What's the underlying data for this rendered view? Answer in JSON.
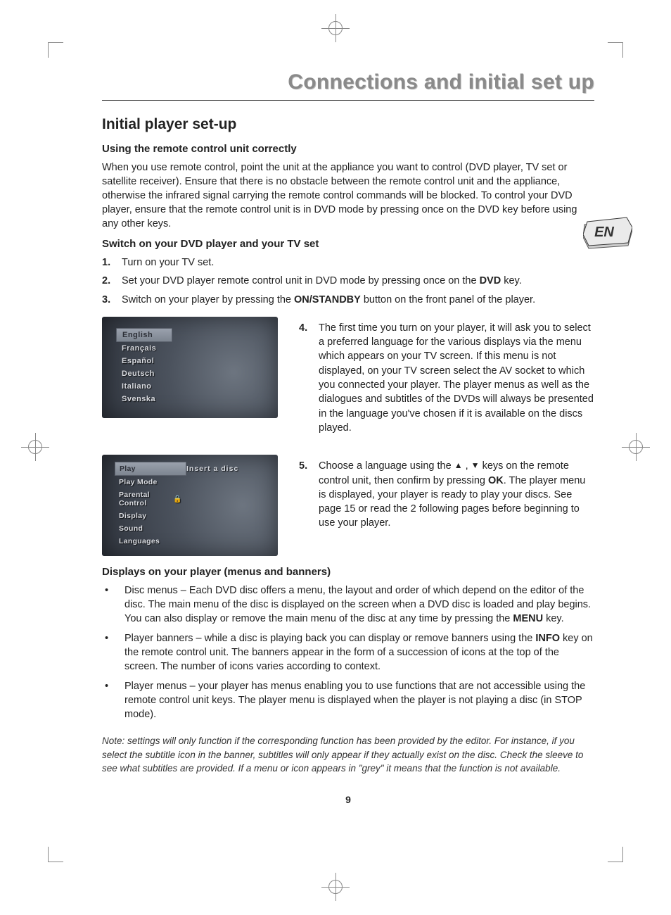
{
  "page_title": "Connections and initial set up",
  "section_heading": "Initial player set-up",
  "sub1_heading": "Using the remote control unit correctly",
  "sub1_body": "When you use remote control, point the unit at the appliance you want to control (DVD player, TV set or satellite receiver). Ensure that there is no obstacle between the remote control unit and the appliance, otherwise the infrared signal carrying the remote control commands will be blocked. To control your DVD player, ensure that the remote control unit is in DVD mode by pressing once on the DVD key before using any other keys.",
  "sub2_heading": "Switch on your DVD player and your TV set",
  "steps_1_3": [
    {
      "n": "1.",
      "text": "Turn on your TV set."
    },
    {
      "n": "2.",
      "pre": "Set your DVD player remote control unit in DVD mode by pressing once on the ",
      "bold": "DVD",
      "post": " key."
    },
    {
      "n": "3.",
      "pre": "Switch on your player by pressing the ",
      "bold": "ON/STANDBY",
      "post": " button on the front panel of the player."
    }
  ],
  "lang_menu": [
    "English",
    "Français",
    "Español",
    "Deutsch",
    "Italiano",
    "Svenska"
  ],
  "lang_selected_index": 0,
  "step4": {
    "n": "4.",
    "text": "The first time you turn on your player, it will ask you to select a preferred language for the various displays via the menu which appears on your TV screen. If this menu is not displayed, on your TV screen select the AV socket to which you connected your player. The player menus as well as the dialogues and subtitles of the DVDs will always be presented in the language you've chosen if it is available on the discs played."
  },
  "player_menu": {
    "items": [
      "Play",
      "Play Mode",
      "Parental Control",
      "Display",
      "Sound",
      "Languages"
    ],
    "selected_index": 0,
    "lock_index": 2,
    "right_label": "Insert a disc"
  },
  "step5": {
    "n": "5.",
    "pre1": "Choose a language using the ",
    "mid": " keys on the remote control unit, then confirm by pressing ",
    "bold": "OK",
    "post": ". The player menu is displayed, your player is ready to play your discs. See page 15 or read the 2 following pages before beginning to use your player."
  },
  "sub3_heading": "Displays on your player (menus and banners)",
  "bullets": [
    {
      "pre": "Disc menus – Each DVD disc offers a menu, the layout and order of which depend on the editor of the disc. The main menu of the disc is displayed on the screen when a DVD disc is loaded and play begins. You can also display or remove the main menu of the disc at any time by pressing the ",
      "bold": "MENU",
      "post": " key."
    },
    {
      "pre": "Player banners – while a disc is playing back you can display or remove banners using the ",
      "bold": "INFO",
      "post": " key on the remote control unit. The banners appear in the form of a succession of icons at the top of the screen. The number of icons varies according to context."
    },
    {
      "pre": "Player menus – your player has menus enabling you to use functions that are not accessible using the remote control unit keys. The player menu is displayed when the player is not playing a disc (in STOP mode).",
      "bold": "",
      "post": ""
    }
  ],
  "note": "Note: settings will only function if the corresponding function has been provided by the editor. For instance, if you select the subtitle icon in the banner, subtitles will only appear if they actually exist on the disc. Check the sleeve to see what subtitles are provided. If a menu or icon appears in \"grey\" it means that the function is not available.",
  "page_number": "9",
  "badge": "EN"
}
